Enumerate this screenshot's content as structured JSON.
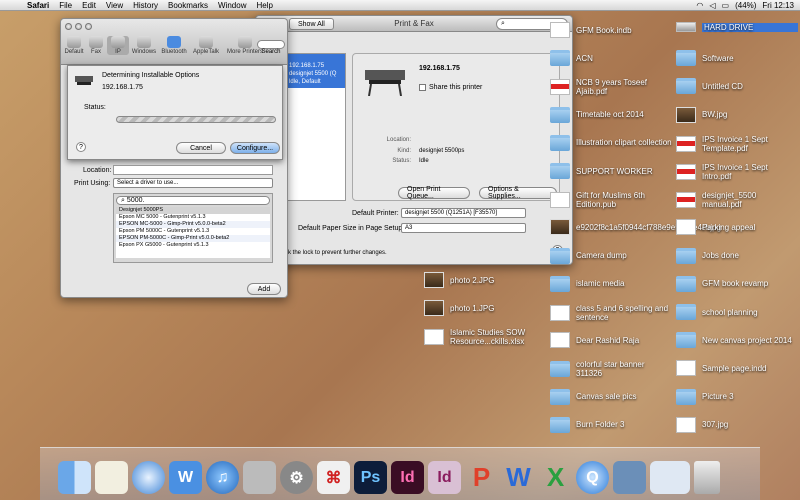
{
  "menubar": {
    "app": "Safari",
    "items": [
      "File",
      "Edit",
      "View",
      "History",
      "Bookmarks",
      "Window",
      "Help"
    ],
    "battery": "(44%)",
    "clock": "Fri 12:13"
  },
  "printfax": {
    "title": "Print & Fax",
    "show_all": "Show All",
    "printer_ip": "192.168.1.75",
    "share_label": "Share this printer",
    "location_label": "Location:",
    "kind_label": "Kind:",
    "kind_value": "designjet 5500ps",
    "status_label": "Status:",
    "status_value": "Idle",
    "open_queue": "Open Print Queue...",
    "options": "Options & Supplies...",
    "default_printer_label": "Default Printer:",
    "default_printer_value": "designjet 5500 (Q1251A) [F35570]",
    "paper_label": "Default Paper Size in Page Setup:",
    "paper_value": "A3",
    "lock_text": "k the lock to prevent further changes.",
    "list_items": [
      "192.168.1.75",
      "designjet 5500 (Q",
      "ldle, Default"
    ]
  },
  "addprinter": {
    "toolbar": [
      "Default",
      "Fax",
      "IP",
      "Windows",
      "Bluetooth",
      "AppleTalk",
      "More Printers",
      "Search"
    ],
    "determining": "Determining Installable Options",
    "ip": "192.168.1.75",
    "status_label": "Status:",
    "cancel": "Cancel",
    "configure": "Configure...",
    "location_label": "Location:",
    "print_using_label": "Print Using:",
    "print_using_value": "Select a driver to use...",
    "search_value": "5000.",
    "drivers": [
      "Designjet 5000PS",
      "Epson MC 5000 - Gutenprint v5.1.3",
      "EPSON MC-5000 - Gimp-Print v5.0.0-beta2",
      "Epson PM 5000C - Gutenprint v5.1.3",
      "EPSON PM-5000C - Gimp-Print v5.0.0-beta2",
      "Epson PX G5000 - Gutenprint v5.1.3"
    ],
    "add": "Add"
  },
  "desktop": {
    "col1": [
      {
        "label": "photo 2.JPG",
        "icon": "img"
      },
      {
        "label": "photo 1.JPG",
        "icon": "img"
      },
      {
        "label": "Islamic Studies SOW Resource...ckills.xlsx",
        "icon": "doc"
      }
    ],
    "col2": [
      {
        "label": "GFM Book.indb",
        "icon": "doc"
      },
      {
        "label": "ACN",
        "icon": "folder"
      },
      {
        "label": "NCB 9 years Toseef Ajaib.pdf",
        "icon": "pdf"
      },
      {
        "label": "Timetable oct 2014",
        "icon": "folder"
      },
      {
        "label": "Illustration clipart collection",
        "icon": "folder"
      },
      {
        "label": "SUPPORT WORKER",
        "icon": "folder"
      },
      {
        "label": "Gift for Muslims 6th Edition.pub",
        "icon": "doc"
      },
      {
        "label": "e9202f8c1a5f0944cf788e9e5160e4cbjpg",
        "icon": "img"
      },
      {
        "label": "Camera dump",
        "icon": "folder"
      },
      {
        "label": "islamic media",
        "icon": "folder"
      },
      {
        "label": "class 5 and 6 spelling and sentence",
        "icon": "doc"
      },
      {
        "label": "Dear Rashid Raja",
        "icon": "doc"
      },
      {
        "label": "colorful star banner 311326",
        "icon": "folder"
      },
      {
        "label": "Canvas sale pics",
        "icon": "folder"
      },
      {
        "label": "Burn Folder 3",
        "icon": "folder"
      }
    ],
    "col3": [
      {
        "label": "HARD DRIVE",
        "icon": "drive"
      },
      {
        "label": "Software",
        "icon": "folder"
      },
      {
        "label": "Untitled CD",
        "icon": "folder"
      },
      {
        "label": "BW.jpg",
        "icon": "img"
      },
      {
        "label": "IPS Invoice 1 Sept Template.pdf",
        "icon": "pdf"
      },
      {
        "label": "IPS Invoice 1 Sept Intro.pdf",
        "icon": "pdf"
      },
      {
        "label": "designjet_5500 manual.pdf",
        "icon": "pdf"
      },
      {
        "label": "Parking appeal",
        "icon": "doc"
      },
      {
        "label": "Jobs done",
        "icon": "folder"
      },
      {
        "label": "GFM book revamp",
        "icon": "folder"
      },
      {
        "label": "school planning",
        "icon": "folder"
      },
      {
        "label": "New canvas project 2014",
        "icon": "folder"
      },
      {
        "label": "Sample page.indd",
        "icon": "doc"
      },
      {
        "label": "Picture 3",
        "icon": "folder"
      },
      {
        "label": "307.jpg",
        "icon": "doc"
      }
    ]
  },
  "dock": [
    "Finder",
    "TextEdit",
    "Safari",
    "Wacom",
    "iTunes",
    "Utility",
    "System Preferences",
    "Acrobat",
    "Photoshop",
    "InDesign",
    "InDesign",
    "Publisher",
    "Word",
    "Excel",
    "QuickTime",
    "Preview",
    "Finder Window",
    "Trash"
  ]
}
